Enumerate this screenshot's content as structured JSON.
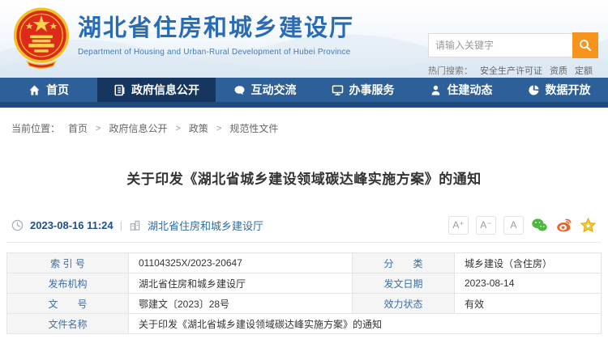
{
  "header": {
    "title": "湖北省住房和城乡建设厅",
    "subtitle": "Department of Housing and Urban-Rural Development of Hubei Province",
    "search": {
      "placeholder": "请输入关键字"
    },
    "hot_search": {
      "label": "热门搜索：",
      "items": [
        "安全生产许可证",
        "资质",
        "定额"
      ]
    }
  },
  "nav": {
    "items": [
      {
        "label": "首页",
        "icon": "home-icon",
        "active": false
      },
      {
        "label": "政府信息公开",
        "icon": "document-icon",
        "active": true
      },
      {
        "label": "互动交流",
        "icon": "chat-icon",
        "active": false
      },
      {
        "label": "办事服务",
        "icon": "monitor-icon",
        "active": false
      },
      {
        "label": "住建动态",
        "icon": "person-icon",
        "active": false
      },
      {
        "label": "数据开放",
        "icon": "pie-chart-icon",
        "active": false
      }
    ]
  },
  "breadcrumb": {
    "label": "当前位置：",
    "separator": ">",
    "items": [
      "首页",
      "政府信息公开",
      "政策",
      "规范性文件"
    ]
  },
  "article": {
    "title": "关于印发《湖北省城乡建设领域碳达峰实施方案》的通知",
    "date": "2023-08-16 11:24",
    "separator": "|",
    "source": "湖北省住房和城乡建设厅",
    "font_buttons": [
      "A⁺",
      "A⁻",
      "A"
    ]
  },
  "doc_table": {
    "index_label": "索 引 号",
    "index_value": "01104325X/2023-20647",
    "category_label": "分　　类",
    "category_value": "城乡建设（含住房）",
    "publisher_label": "发布机构",
    "publisher_value": "湖北省住房和城乡建设厅",
    "pub_date_label": "发文日期",
    "pub_date_value": "2023-08-14",
    "doc_number_label": "文　　号",
    "doc_number_value": "鄂建文〔2023〕28号",
    "validity_label": "效力状态",
    "validity_value": "有效",
    "doc_name_label": "文件名称",
    "doc_name_value": "关于印发《湖北省城乡建设领域碳达峰实施方案》的通知"
  },
  "colors": {
    "nav_bg": "#2d5f99",
    "nav_active_bg": "#16365f",
    "nav_strip": "#1e4a80",
    "search_button_orange": "#f7941e",
    "title_blue": "#2a6cb3",
    "table_label_blue": "#3a6ea5",
    "wechat_green": "#4db93e",
    "weibo_orange": "#e6642d",
    "star_yellow": "#f5c522"
  }
}
